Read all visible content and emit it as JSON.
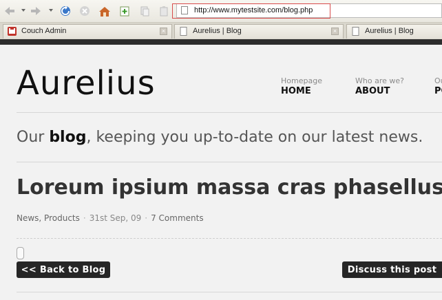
{
  "browser": {
    "url": "http://www.mytestsite.com/blog.php",
    "tabs": [
      {
        "label": "Couch Admin"
      },
      {
        "label": "Aurelius | Blog"
      },
      {
        "label": "Aurelius | Blog"
      }
    ]
  },
  "site": {
    "logo": "Aurelius",
    "nav": [
      {
        "sub": "Homepage",
        "main": "HOME"
      },
      {
        "sub": "Who are we?",
        "main": "ABOUT"
      },
      {
        "sub": "Ou",
        "main": "PO"
      }
    ],
    "tagline": {
      "prefix": "Our ",
      "strong": "blog",
      "suffix": ", keeping you up-to-date on our latest news."
    },
    "post": {
      "title": "Loreum ipsium massa cras phasellus",
      "categories": "News, Products",
      "separator": "·",
      "date": "31st Sep, 09",
      "comments": "7 Comments"
    },
    "buttons": {
      "back": "<< Back to Blog",
      "discuss": "Discuss this post"
    }
  },
  "colors": {
    "accent_button": "#262626",
    "url_highlight": "#d84b4b",
    "page_bg": "#f2f2f2"
  }
}
